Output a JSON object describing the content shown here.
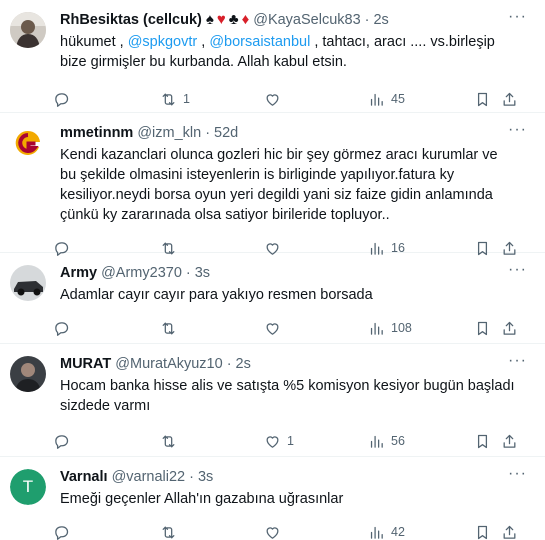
{
  "tweets": [
    {
      "name": "RhBesiktas (cellcuk)",
      "suits": [
        "♠",
        "♥",
        "♣",
        "♦"
      ],
      "handle": "@KayaSelcuk83",
      "time": "2s",
      "text_before": "hükumet , ",
      "mention1": "@spkgovtr",
      "text_mid": " , ",
      "mention2": "@borsaistanbul",
      "text_after": " , tahtacı, aracı .... vs.birleşip bize girmişler bu kurbanda. Allah kabul etsin.",
      "replies": "",
      "retweets": "1",
      "likes": "",
      "views": "45",
      "avatar_icon": "person-photo-icon"
    },
    {
      "name": "mmetinnm",
      "handle": "@izm_kln",
      "time": "52d",
      "text": "Kendi kazanclari olunca gozleri hic bir şey görmez aracı kurumlar ve bu şekilde olmasini isteyenlerin is birliginde yapılıyor.fatura ky kesiliyor.neydi borsa oyun yeri degildi yani siz faize gidin anlamında çünkü ky zararınada olsa satiyor birileride topluyor..",
      "replies": "",
      "retweets": "",
      "likes": "",
      "views": "16",
      "avatar_icon": "galatasaray-logo-icon"
    },
    {
      "name": "Army",
      "handle": "@Army2370",
      "time": "3s",
      "text": "Adamlar  cayır cayır para yakıyo resmen borsada",
      "replies": "",
      "retweets": "",
      "likes": "",
      "views": "108",
      "avatar_icon": "car-photo-icon"
    },
    {
      "name": "MURAT",
      "handle": "@MuratAkyuz10",
      "time": "2s",
      "text": "Hocam banka hisse alis ve satışta %5 komisyon kesiyor bugün başladı sizdede varmı",
      "replies": "",
      "retweets": "",
      "likes": "1",
      "views": "56",
      "avatar_icon": "person-photo-icon"
    },
    {
      "name": "Varnalı",
      "handle": "@varnali22",
      "time": "3s",
      "text": "Emeği geçenler Allah'ın gazabına uğrasınlar",
      "replies": "",
      "retweets": "",
      "likes": "",
      "views": "42",
      "avatar_letter": "T",
      "avatar_color": "#1f9e6e"
    }
  ],
  "colors": {
    "accent": "#1d9bf0",
    "muted": "#536471",
    "divider": "#eff3f4"
  },
  "icons": [
    "reply-icon",
    "retweet-icon",
    "like-icon",
    "views-icon",
    "bookmark-icon",
    "share-icon",
    "more-icon"
  ]
}
